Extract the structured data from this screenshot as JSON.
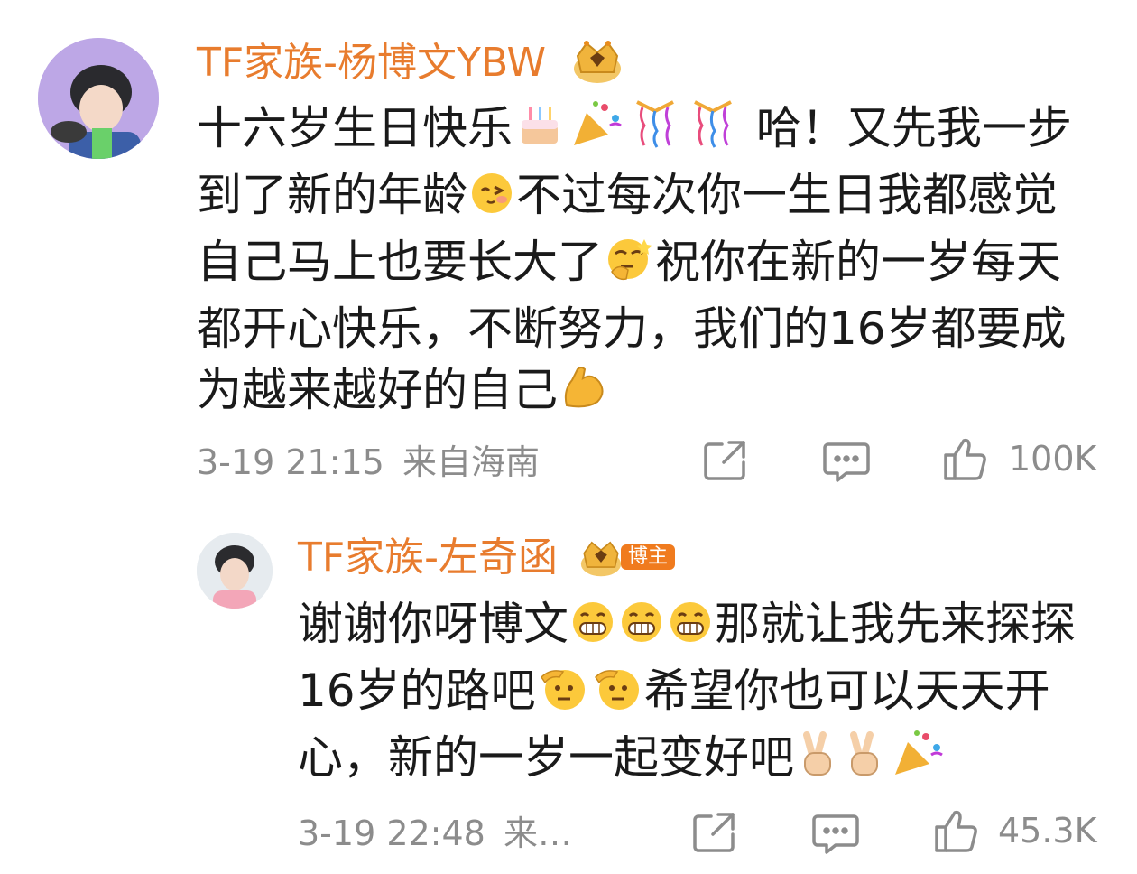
{
  "comment": {
    "username": "TF家族-杨博文YBW",
    "text_segments": [
      "十六岁生日快乐",
      "哈！又先我一步到了新的年龄",
      "不过每次你一生日我都感觉自己马上也要长大了",
      "祝你在新的一岁每天都开心快乐，不断努力，我们的16岁都要成为越来越好的自己"
    ],
    "time": "3-19 21:15",
    "location": "来自海南",
    "likes": "100K",
    "emoji_names": [
      "cake-emoji",
      "party-popper-emoji",
      "celebration-emoji",
      "celebration-emoji",
      "cute-face-emoji",
      "thinking-face-emoji",
      "flexed-biceps-emoji"
    ]
  },
  "reply": {
    "username": "TF家族-左奇函",
    "author_tag": "博主",
    "text_segments": [
      "谢谢你呀博文",
      "那就让我先来探探16岁的路吧",
      "希望你也可以天天开心，新的一岁一起变好吧"
    ],
    "time": "3-19 22:48",
    "location": "来…",
    "likes": "45.3K",
    "emoji_names": [
      "grin-emoji",
      "grin-emoji",
      "grin-emoji",
      "salute-emoji",
      "salute-emoji",
      "victory-hand-emoji",
      "victory-hand-emoji",
      "party-popper-emoji"
    ]
  },
  "colors": {
    "username": "#e87c2e",
    "meta": "#8c8c8c",
    "text": "#1a1a1a",
    "tag_bg": "#f07b1e"
  },
  "icons": [
    "share-icon",
    "comment-icon",
    "like-icon",
    "crown-badge-icon"
  ]
}
